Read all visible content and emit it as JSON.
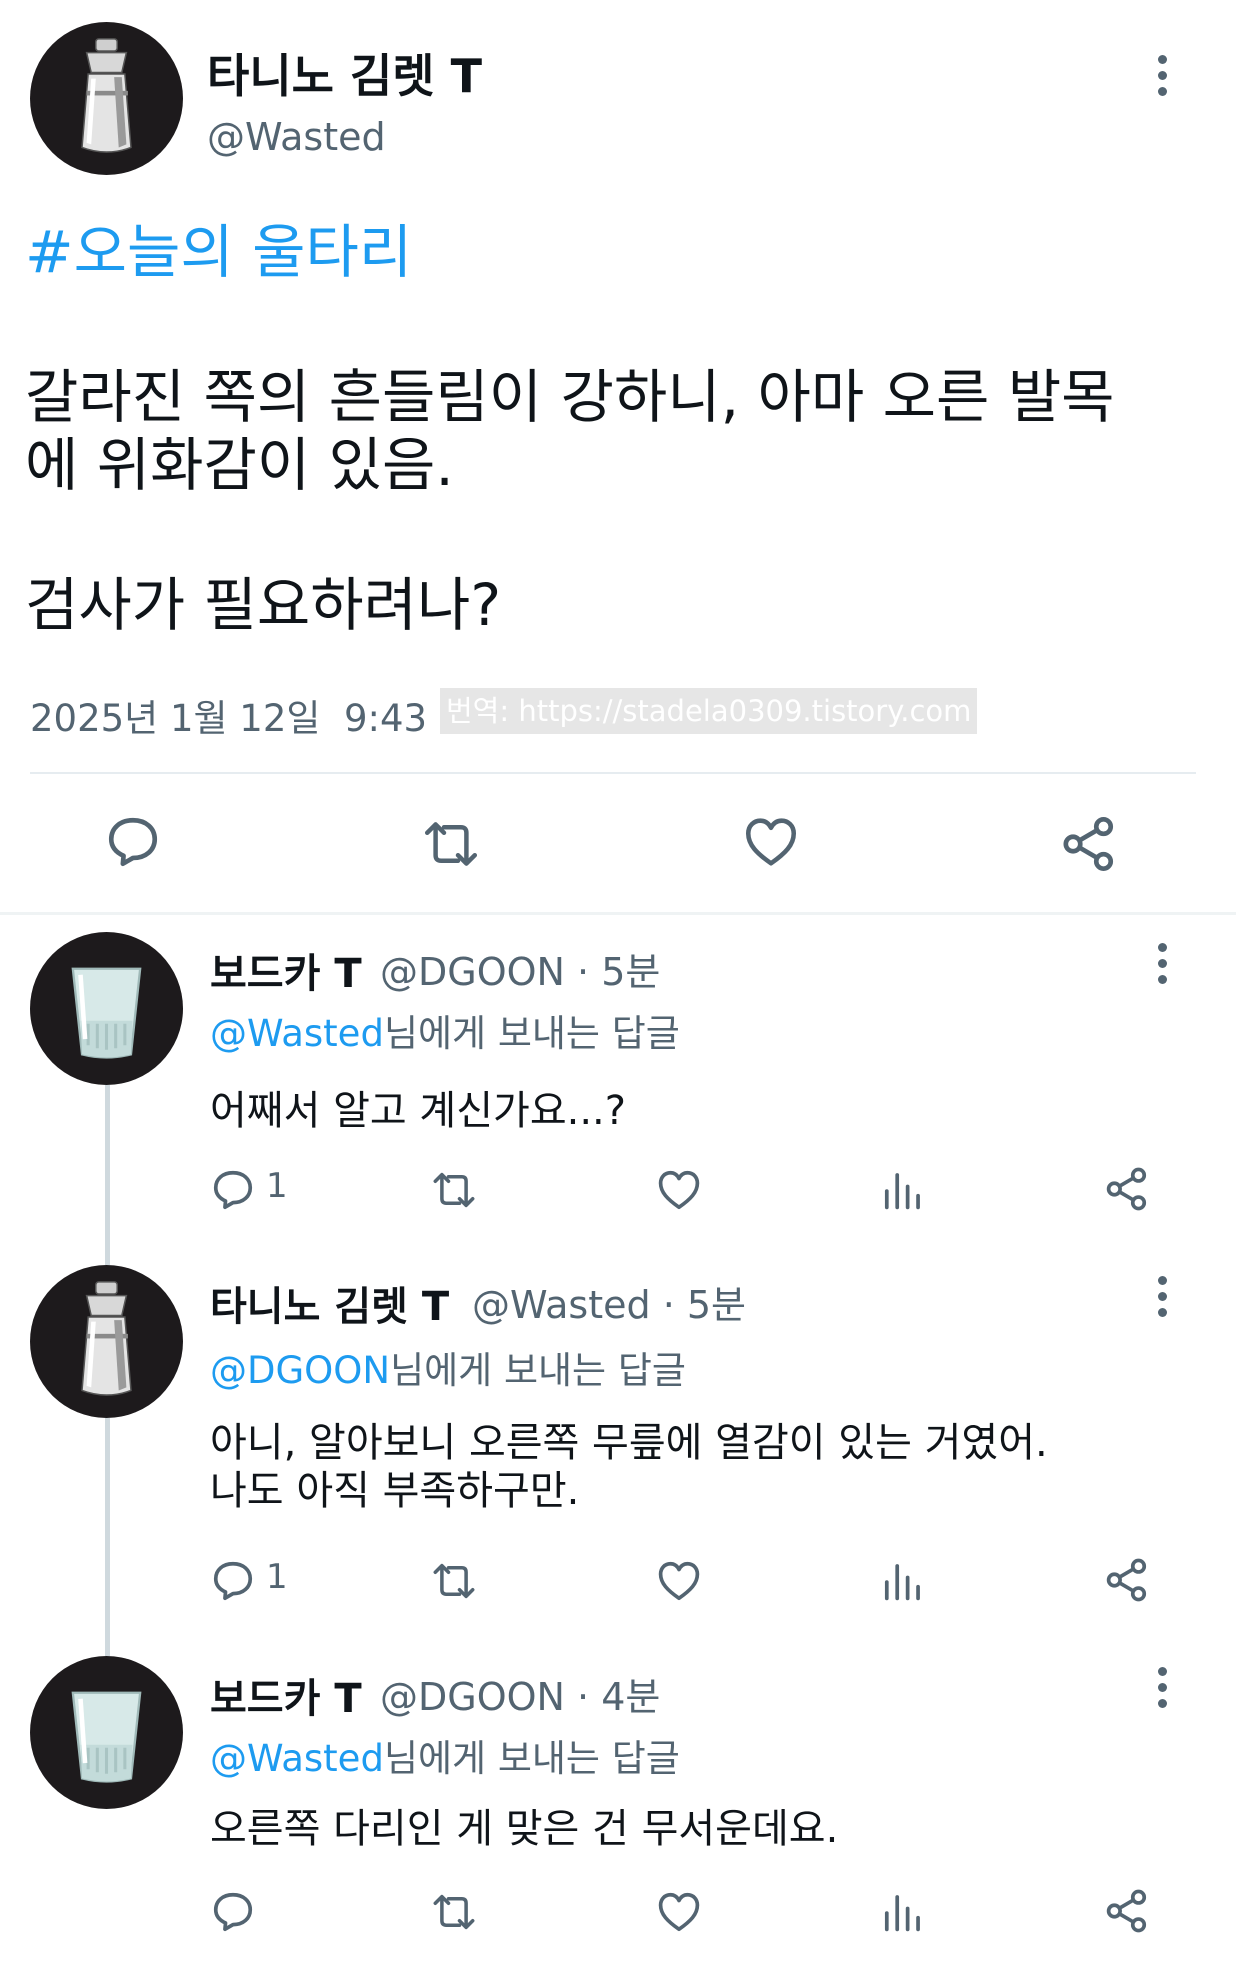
{
  "main_tweet": {
    "display_name": "타니노 김렛 T",
    "handle": "@Wasted",
    "hashtag": "#오늘의 울타리",
    "body_line1": "갈라진 쪽의 흔들림이 강하니, 아마 오른 발목",
    "body_line2": "에 위화감이 있음.",
    "body_line3": "검사가 필요하려나?",
    "timestamp": "2025년 1월 12일  9:43",
    "watermark": "번역: https://stadela0309.tistory.com"
  },
  "replies": [
    {
      "display_name": "보드카 T",
      "handle_time": "@DGOON · 5분",
      "reply_to_handle": "@Wasted",
      "reply_to_suffix": "님에게 보내는 답글",
      "text_line1": "어째서 알고 계신가요...?",
      "text_line2": "",
      "reply_count": "1"
    },
    {
      "display_name": "타니노 김렛 T",
      "handle_time": "@Wasted · 5분",
      "reply_to_handle": "@DGOON",
      "reply_to_suffix": "님에게 보내는 답글",
      "text_line1": "아니, 알아보니 오른쪽 무릎에 열감이 있는 거였어.",
      "text_line2": "나도 아직 부족하구만.",
      "reply_count": "1"
    },
    {
      "display_name": "보드카 T",
      "handle_time": "@DGOON · 4분",
      "reply_to_handle": "@Wasted",
      "reply_to_suffix": "님에게 보내는 답글",
      "text_line1": "오른쪽 다리인 게 맞은 건 무서운데요.",
      "text_line2": "",
      "reply_count": ""
    }
  ],
  "icons": {
    "reply": "reply-bubble-icon",
    "retweet": "retweet-icon",
    "like": "heart-icon",
    "share": "share-icon",
    "analytics": "analytics-bars-icon",
    "more": "more-vertical-icon"
  },
  "colors": {
    "accent": "#1d9bf0",
    "secondary_text": "#536471",
    "avatar_bg": "#1d1a1c"
  }
}
